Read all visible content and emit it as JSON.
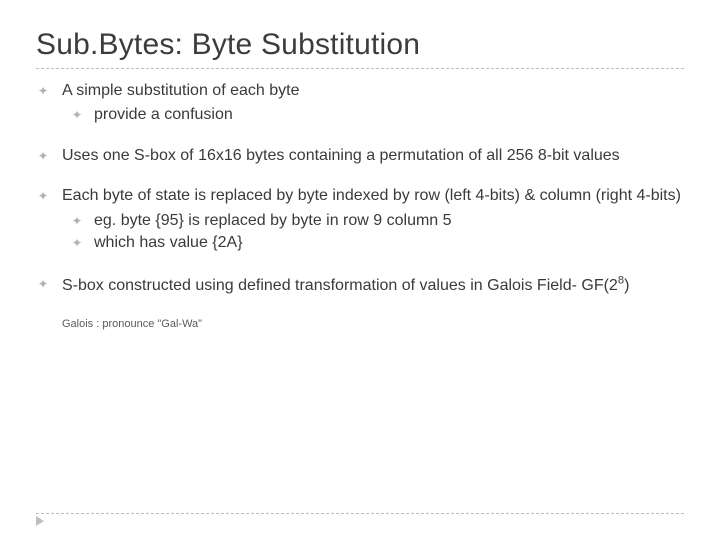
{
  "title": "Sub.Bytes: Byte Substitution",
  "bullets": [
    {
      "text": "A simple substitution of each byte",
      "sub": [
        {
          "text": "provide a confusion"
        }
      ]
    },
    {
      "text": "Uses one S-box of 16x16 bytes containing a permutation of all 256 8-bit values"
    },
    {
      "text": "Each byte of state is replaced by byte indexed by row (left 4-bits) & column (right 4-bits)",
      "sub": [
        {
          "text": "eg. byte {95} is replaced by byte in row 9 column 5"
        },
        {
          "text": "which has value {2A}"
        }
      ]
    },
    {
      "text_html": "S-box constructed using defined transformation of values in Galois Field- GF(2<sup>8</sup>)"
    }
  ],
  "note": "Galois : pronounce \"Gal-Wa\"",
  "bullet_glyph": "✦"
}
